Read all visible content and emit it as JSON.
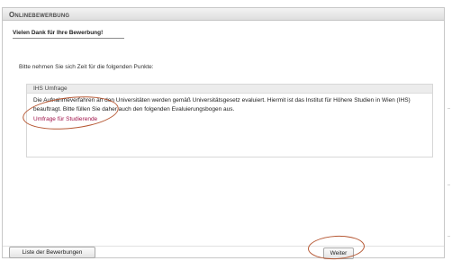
{
  "window": {
    "title": "Onlinebewerbung"
  },
  "main": {
    "thanks_heading": "Vielen Dank für Ihre Bewerbung!",
    "intro_text": "Bitte nehmen Sie sich Zeit für die folgenden Punkte:"
  },
  "survey_box": {
    "header": "IHS Umfrage",
    "body": "Die Aufnahmeverfahren an den Universitäten werden gemäß Universitätsgesetz evaluiert. Hiermit ist das Institut für Höhere Studien in Wien (IHS) beauftragt. Bitte füllen Sie daher auch den folgenden Evaluierungsbogen aus.",
    "link_label": "Umfrage für Studierende"
  },
  "footer": {
    "list_button_label": "Liste der Bewerbungen",
    "next_button_label": "Weiter"
  },
  "colors": {
    "link": "#a0134a",
    "annotation_ring": "#b65834"
  }
}
